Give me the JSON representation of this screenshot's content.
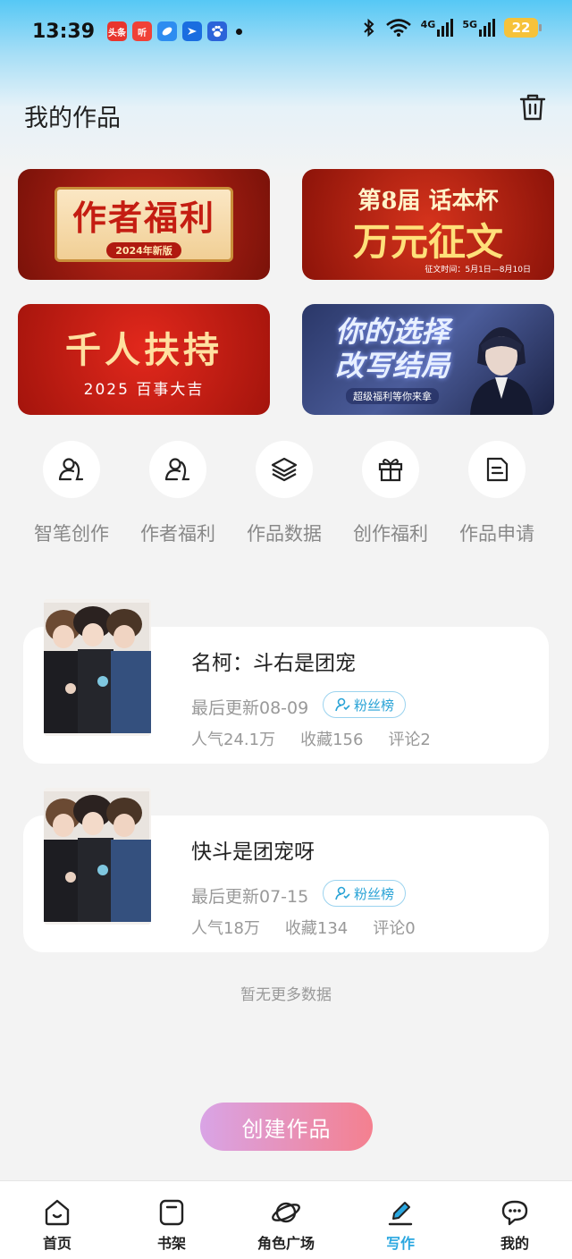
{
  "status_bar": {
    "time": "13:39",
    "notifications": [
      {
        "name": "toutiao-icon",
        "label": "头条",
        "color": "#e8352d"
      },
      {
        "name": "ting-icon",
        "label": "听",
        "color": "#f04137"
      },
      {
        "name": "browser-icon",
        "label": "",
        "color": "#2d8cf0"
      },
      {
        "name": "feishu-icon",
        "label": "",
        "color": "#1a6de0"
      },
      {
        "name": "baidu-icon",
        "label": "",
        "color": "#2b63d9"
      }
    ],
    "network_1": "4G",
    "network_2": "5G",
    "battery": "22"
  },
  "header": {
    "title": "我的作品"
  },
  "banners": {
    "b1_main": "作者福利",
    "b1_sub": "2024年新版",
    "b2_top": "第8届 话本杯",
    "b2_main": "万元征文",
    "b2_sub": "征文时间：5月1日—8月10日",
    "b3_main": "千人扶持",
    "b3_sub": "2025 百事大吉",
    "b4_main_1": "你的选择",
    "b4_main_2": "改写结局",
    "b4_sub": "超级福利等你来拿"
  },
  "quick_menu": [
    {
      "label": "智笔创作",
      "icon": "user-pen-icon"
    },
    {
      "label": "作者福利",
      "icon": "user-pen-icon"
    },
    {
      "label": "作品数据",
      "icon": "layers-icon"
    },
    {
      "label": "创作福利",
      "icon": "gift-icon"
    },
    {
      "label": "作品申请",
      "icon": "document-icon"
    }
  ],
  "works": [
    {
      "title": "名柯：斗右是团宠",
      "last_update": "最后更新08-09",
      "badge": "粉丝榜",
      "popularity": "人气24.1万",
      "favorites": "收藏156",
      "comments": "评论2"
    },
    {
      "title": "快斗是团宠呀",
      "last_update": "最后更新07-15",
      "badge": "粉丝榜",
      "popularity": "人气18万",
      "favorites": "收藏134",
      "comments": "评论0"
    }
  ],
  "no_more_text": "暂无更多数据",
  "create_button": "创建作品",
  "bottom_nav": [
    {
      "label": "首页",
      "icon": "home-icon"
    },
    {
      "label": "书架",
      "icon": "bookshelf-icon"
    },
    {
      "label": "角色广场",
      "icon": "planet-icon"
    },
    {
      "label": "写作",
      "icon": "write-icon",
      "active": true
    },
    {
      "label": "我的",
      "icon": "chat-icon"
    }
  ],
  "colors": {
    "accent": "#2aa7e0",
    "create_start": "#d9a4e6",
    "create_end": "#f4808f"
  }
}
